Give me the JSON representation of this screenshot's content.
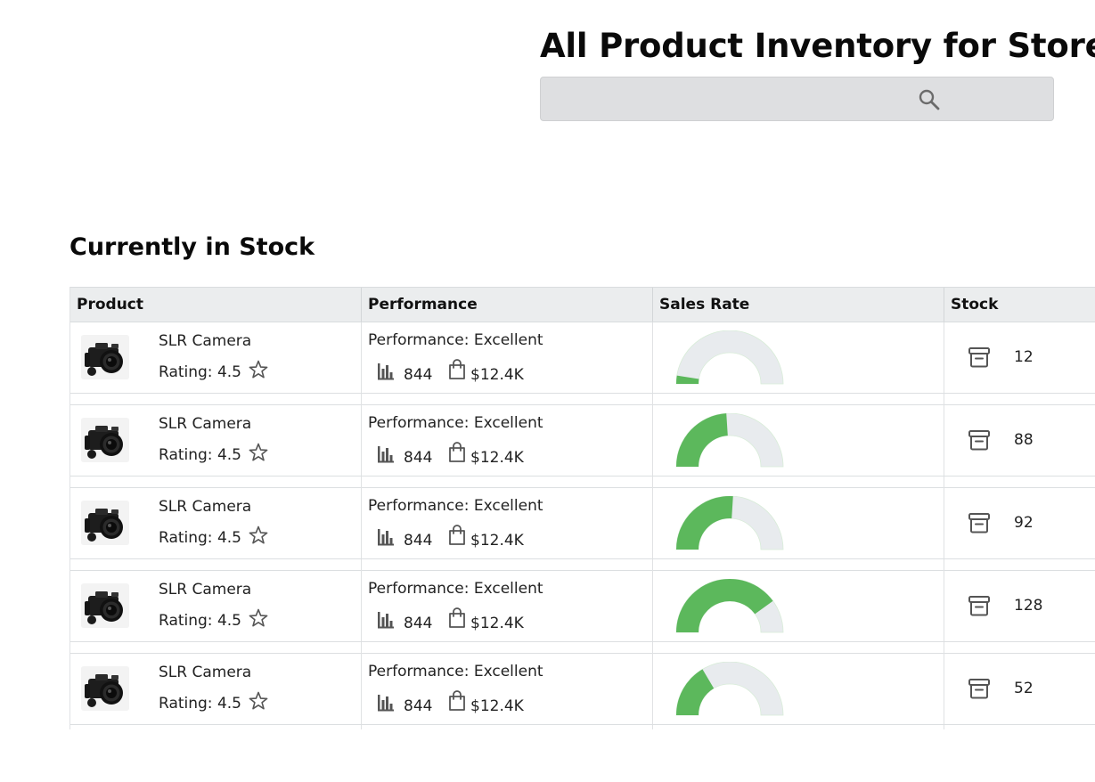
{
  "header": {
    "title": "All Product Inventory for Store",
    "search": {
      "value": "",
      "placeholder": "",
      "icon": "search-icon"
    }
  },
  "section": {
    "title": "Currently in Stock"
  },
  "table": {
    "columns": [
      "Product",
      "Performance",
      "Sales Rate",
      "Stock"
    ],
    "rows": [
      {
        "product": "SLR Camera",
        "rating": "Rating: 4.5",
        "performance": "Performance: Excellent",
        "sales_count": "844",
        "revenue": "$12.4K",
        "sales_rate": 0.05,
        "stock": "12"
      },
      {
        "product": "SLR Camera",
        "rating": "Rating: 4.5",
        "performance": "Performance: Excellent",
        "sales_count": "844",
        "revenue": "$12.4K",
        "sales_rate": 0.48,
        "stock": "88"
      },
      {
        "product": "SLR Camera",
        "rating": "Rating: 4.5",
        "performance": "Performance: Excellent",
        "sales_count": "844",
        "revenue": "$12.4K",
        "sales_rate": 0.52,
        "stock": "92"
      },
      {
        "product": "SLR Camera",
        "rating": "Rating: 4.5",
        "performance": "Performance: Excellent",
        "sales_count": "844",
        "revenue": "$12.4K",
        "sales_rate": 0.8,
        "stock": "128"
      },
      {
        "product": "SLR Camera",
        "rating": "Rating: 4.5",
        "performance": "Performance: Excellent",
        "sales_count": "844",
        "revenue": "$12.4K",
        "sales_rate": 0.33,
        "stock": "52"
      }
    ]
  },
  "colors": {
    "gauge_fill": "#5cb85c",
    "gauge_track": "#e8ebee",
    "header_bg": "#ebedee",
    "search_bg": "#dedfe1"
  },
  "icons": {
    "rating": "star-icon",
    "sales": "bar-chart-icon",
    "revenue": "shopping-bag-icon",
    "stock": "archive-box-icon",
    "product": "camera-thumbnail"
  }
}
